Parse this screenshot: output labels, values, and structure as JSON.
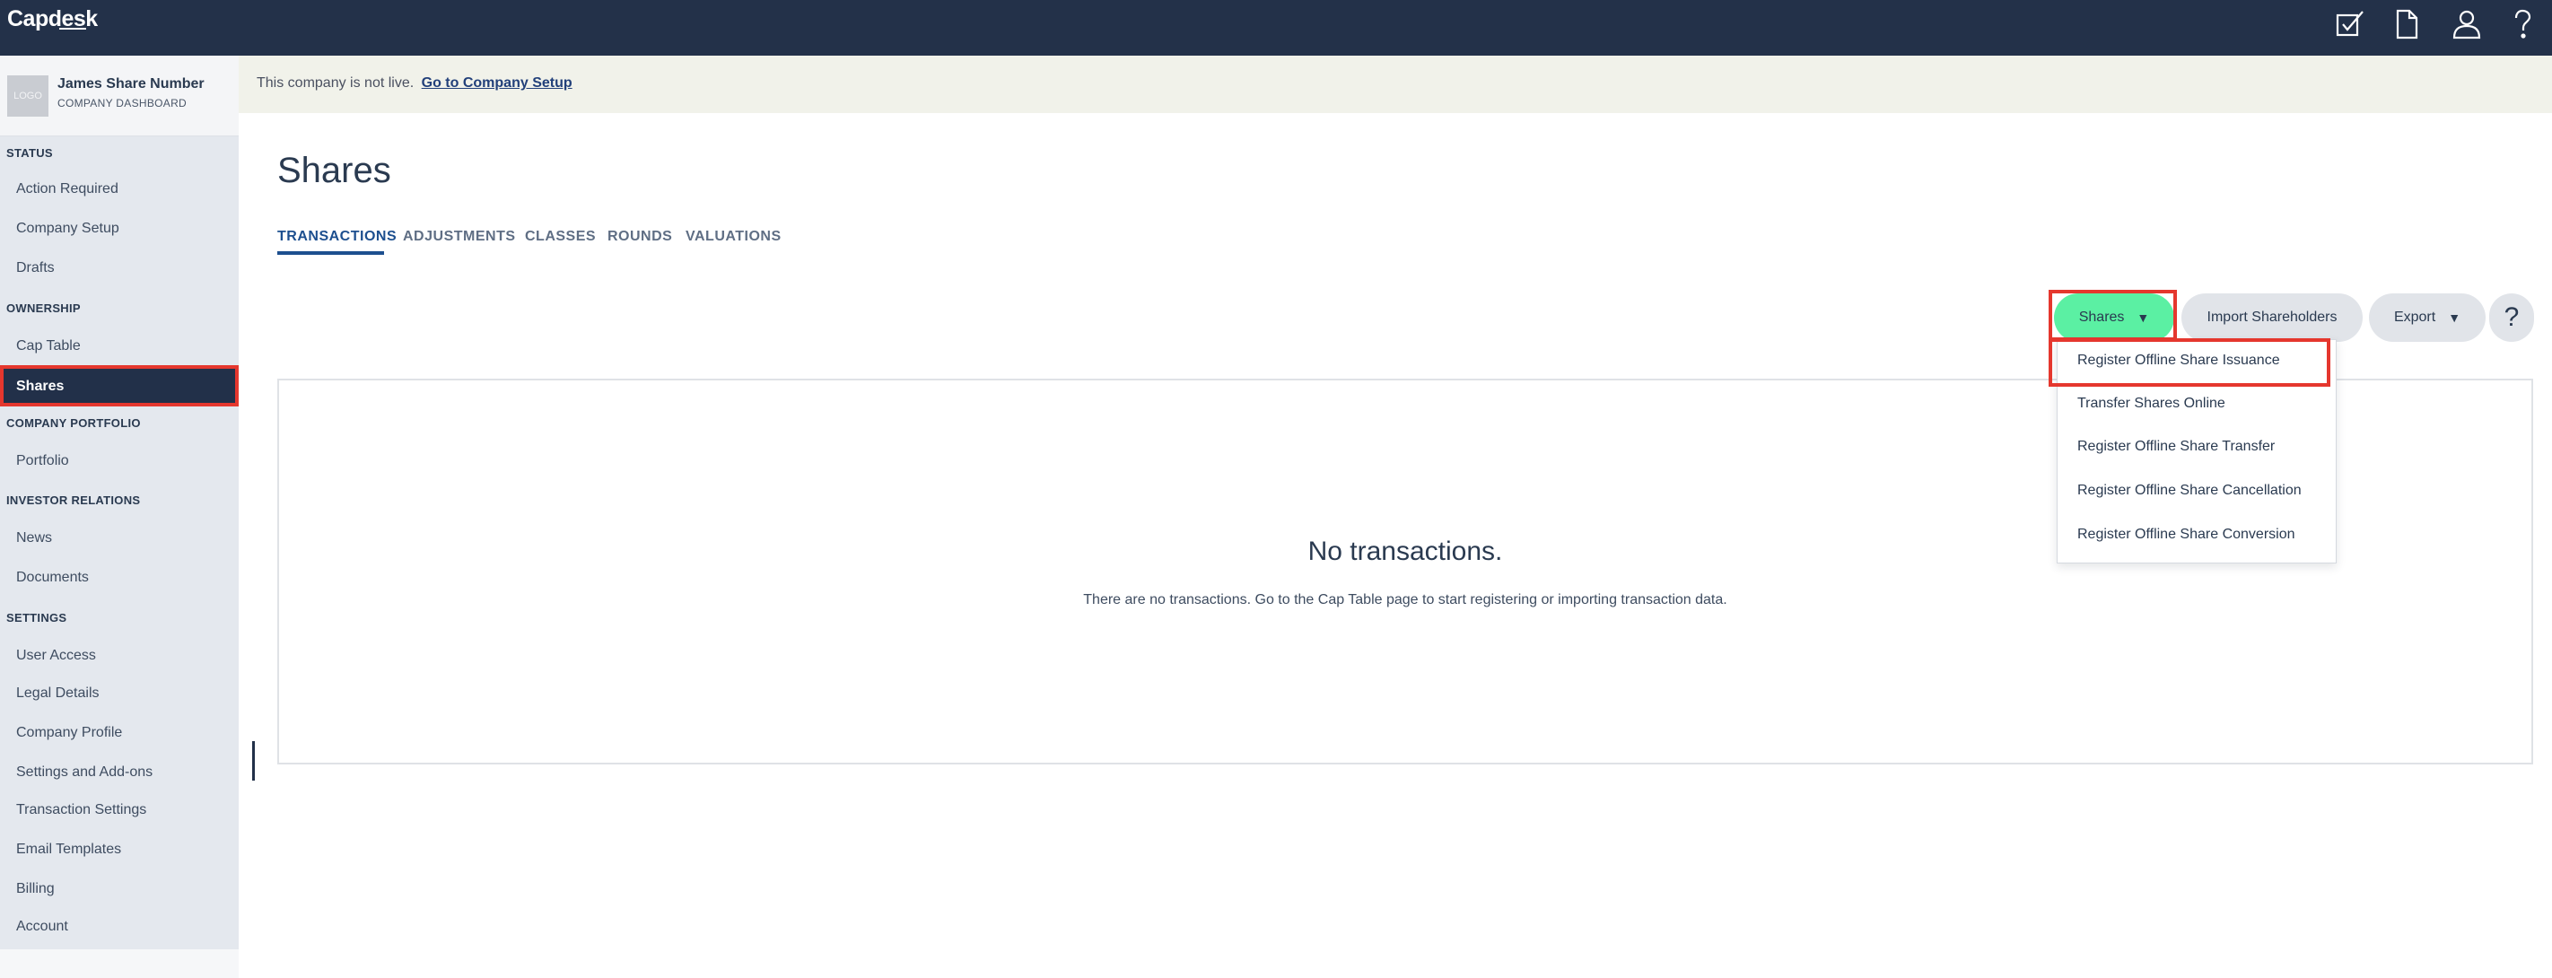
{
  "app": {
    "brand": "Capdesk"
  },
  "topbar": {
    "icons": [
      "checkbox-icon",
      "document-icon",
      "user-icon",
      "help-icon"
    ]
  },
  "company": {
    "logo_text": "LOGO",
    "name": "James Share Number",
    "subtitle": "COMPANY DASHBOARD"
  },
  "sidebar": {
    "status": {
      "title": "STATUS",
      "items": [
        "Action Required",
        "Company Setup",
        "Drafts"
      ]
    },
    "ownership": {
      "title": "OWNERSHIP",
      "items": [
        "Cap Table",
        "Shares"
      ]
    },
    "portfolio": {
      "title": "COMPANY PORTFOLIO",
      "items": [
        "Portfolio"
      ]
    },
    "investor": {
      "title": "INVESTOR RELATIONS",
      "items": [
        "News",
        "Documents"
      ]
    },
    "settings": {
      "title": "SETTINGS",
      "items": [
        "User Access",
        "Legal Details",
        "Company Profile",
        "Settings and Add-ons",
        "Transaction Settings",
        "Email Templates",
        "Billing",
        "Account"
      ]
    },
    "active_item": "Shares"
  },
  "banner": {
    "text": "This company is not live.",
    "link": "Go to Company Setup"
  },
  "page": {
    "title": "Shares",
    "tabs": [
      "TRANSACTIONS",
      "ADJUSTMENTS",
      "CLASSES",
      "ROUNDS",
      "VALUATIONS"
    ],
    "active_tab": "TRANSACTIONS"
  },
  "actions": {
    "shares_button": "Shares",
    "import_button": "Import Shareholders",
    "export_button": "Export",
    "help_button": "?"
  },
  "dropdown": {
    "items": [
      "Register Offline Share Issuance",
      "Transfer Shares Online",
      "Register Offline Share Transfer",
      "Register Offline Share Cancellation",
      "Register Offline Share Conversion"
    ]
  },
  "empty_state": {
    "title": "No transactions.",
    "text": "There are no transactions. Go to the Cap Table page to start registering or importing transaction data."
  },
  "colors": {
    "topbar": "#233149",
    "accent_green": "#5bf0a3",
    "highlight_red": "#e5372e",
    "active_tab": "#1d4f8f"
  }
}
